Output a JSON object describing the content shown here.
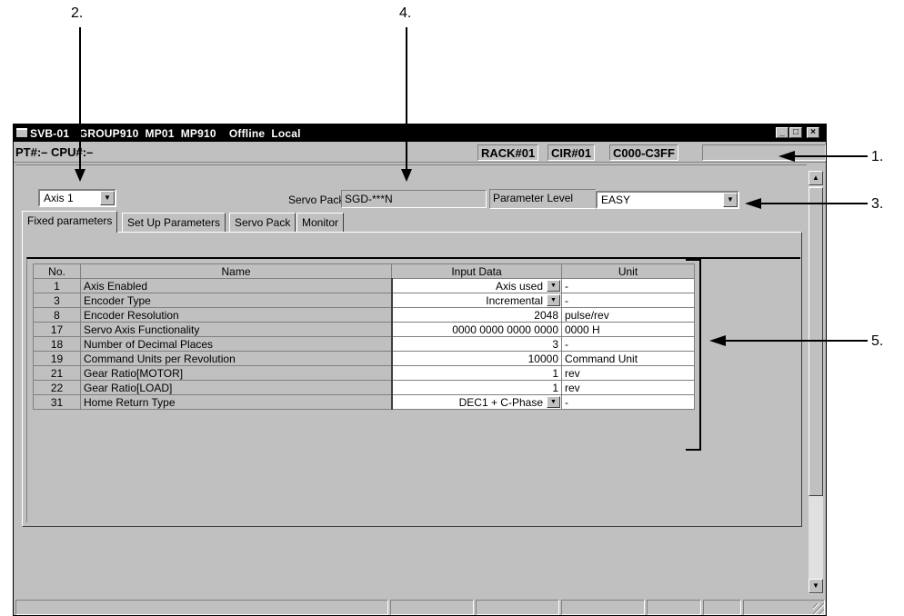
{
  "callouts": {
    "c1": "1.",
    "c2": "2.",
    "c3": "3.",
    "c4": "4.",
    "c5": "5."
  },
  "window": {
    "title": "SVB-01   GROUP910  MP01  MP910    Offline  Local",
    "controls": {
      "minimize": "_",
      "maximize": "□",
      "close": "×"
    }
  },
  "status": {
    "pt_cpu": "PT#:– CPU#:–",
    "rack": "RACK#01",
    "cir": "CIR#01",
    "address": "C000-C3FF"
  },
  "form": {
    "axis_value": "Axis 1",
    "servo_pack_label": "Servo Pack",
    "servo_pack_value": "SGD-***N",
    "param_level_label": "Parameter Level",
    "param_level_value": "EASY"
  },
  "tabs": [
    {
      "label": "Fixed parameters",
      "active": true
    },
    {
      "label": "Set Up Parameters",
      "active": false
    },
    {
      "label": "Servo Pack",
      "active": false
    },
    {
      "label": "Monitor",
      "active": false
    }
  ],
  "table": {
    "headers": {
      "no": "No.",
      "name": "Name",
      "input": "Input Data",
      "unit": "Unit"
    },
    "rows": [
      {
        "no": "1",
        "name": "Axis Enabled",
        "input": "Axis used",
        "unit": "-",
        "dropdown": true
      },
      {
        "no": "3",
        "name": "Encoder Type",
        "input": "Incremental",
        "unit": "-",
        "dropdown": true
      },
      {
        "no": "8",
        "name": "Encoder Resolution",
        "input": "2048",
        "unit": "pulse/rev",
        "dropdown": false
      },
      {
        "no": "17",
        "name": "Servo Axis Functionality",
        "input": "0000 0000 0000 0000",
        "unit": "0000 H",
        "dropdown": false
      },
      {
        "no": "18",
        "name": "Number of Decimal Places",
        "input": "3",
        "unit": "-",
        "dropdown": false
      },
      {
        "no": "19",
        "name": "Command Units per Revolution",
        "input": "10000",
        "unit": "Command Unit",
        "dropdown": false
      },
      {
        "no": "21",
        "name": "Gear Ratio[MOTOR]",
        "input": "1",
        "unit": "rev",
        "dropdown": false
      },
      {
        "no": "22",
        "name": "Gear Ratio[LOAD]",
        "input": "1",
        "unit": "rev",
        "dropdown": false
      },
      {
        "no": "31",
        "name": "Home Return Type",
        "input": "DEC1 + C-Phase",
        "unit": "-",
        "dropdown": true
      }
    ]
  },
  "icons": {
    "dropdown": "▼",
    "scroll_up": "▲",
    "scroll_down": "▼"
  }
}
